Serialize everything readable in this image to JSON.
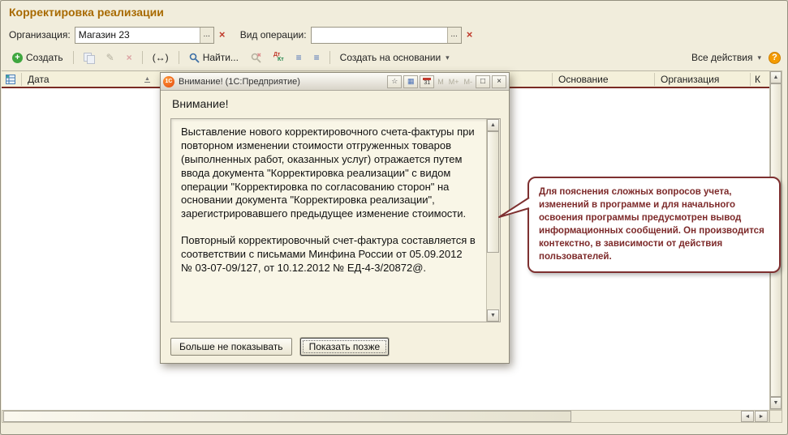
{
  "page": {
    "title": "Корректировка реализации"
  },
  "filters": {
    "org_label": "Организация:",
    "org_value": "Магазин 23",
    "op_label": "Вид операции:",
    "op_value": ""
  },
  "toolbar": {
    "create_label": "Создать",
    "find_label": "Найти...",
    "create_based_label": "Создать на основании",
    "all_actions_label": "Все действия"
  },
  "table": {
    "columns": [
      {
        "label": "Дата"
      },
      {
        "label": "Основание"
      },
      {
        "label": "Организация"
      },
      {
        "label": "К"
      }
    ]
  },
  "dialog": {
    "title": "Внимание! (1С:Предприятие)",
    "heading": "Внимание!",
    "body_p1": "Выставление нового корректировочного счета-фактуры при повторном изменении стоимости отгруженных товаров (выполненных работ, оказанных услуг) отражается путем ввода документа \"Корректировка реализации\" с видом операции \"Корректировка по согласованию сторон\" на основании документа \"Корректировка реализации\", зарегистрировавшего предыдущее изменение стоимости.",
    "body_p2": "Повторный корректировочный счет-фактура составляется в соответствии с письмами Минфина России от 05.09.2012 № 03-07-09/127, от 10.12.2012 № ЕД-4-3/20872@.",
    "btn_dont_show": "Больше не показывать",
    "btn_later": "Показать позже"
  },
  "callout": {
    "text": "Для пояснения сложных вопросов учета, изменений в программе  и для начального освоения программы предусмотрен вывод информационных сообщений. Он производится контекстно, в зависимости от действия пользователей."
  },
  "icons": {
    "ellipsis": "...",
    "clear": "×",
    "edit": "✎",
    "delete": "×",
    "spread": "(↔)",
    "dt": "Дт",
    "kt": "Кт",
    "list": "≡",
    "dropdown": "▾",
    "help": "?",
    "star": "☆",
    "grid": "▦",
    "calendar": "31",
    "mem": "M",
    "mem_plus": "M+",
    "mem_minus": "M-",
    "maximize": "□",
    "close": "×",
    "up": "▲",
    "down": "▼",
    "left": "◄",
    "right": "►",
    "sort": "▲",
    "plus": "+"
  }
}
